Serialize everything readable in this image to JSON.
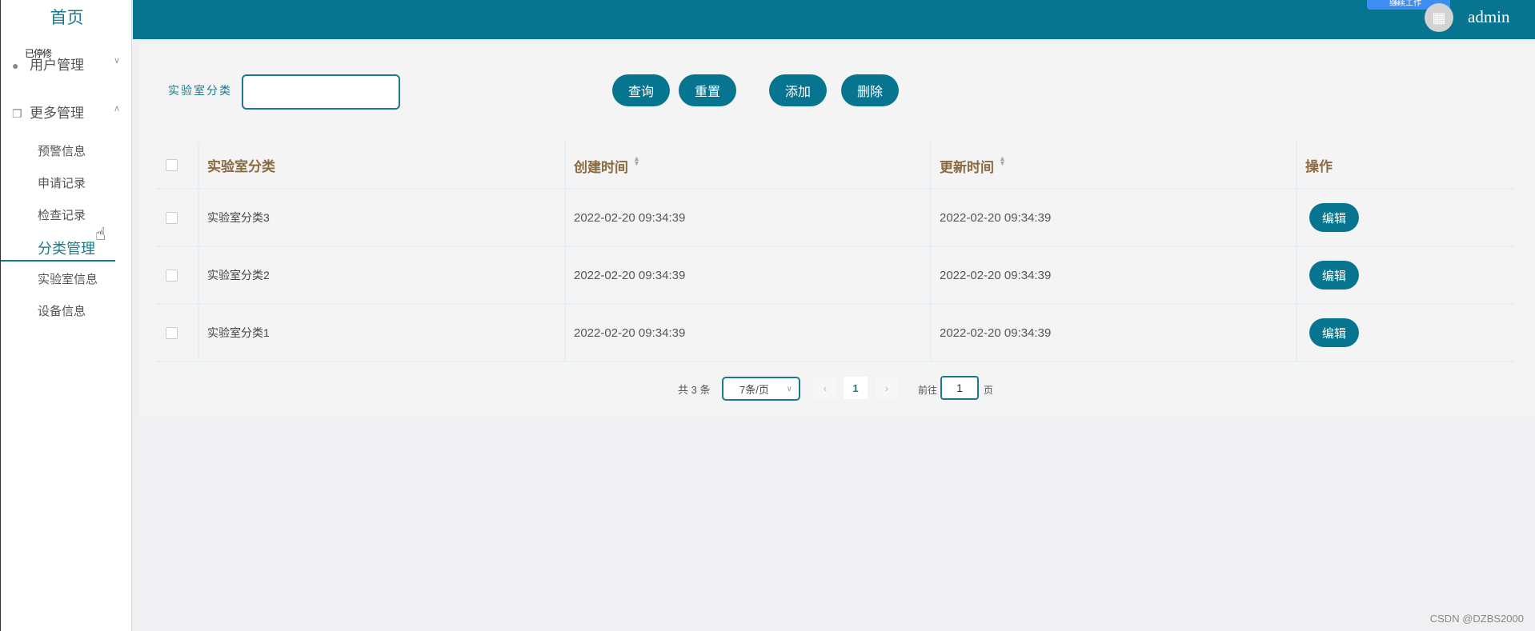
{
  "sidebar": {
    "home": "首页",
    "user_mgmt": "用户管理",
    "overlap_text": "已停修",
    "more_mgmt": "更多管理",
    "items": [
      {
        "label": "预警信息"
      },
      {
        "label": "申请记录"
      },
      {
        "label": "检查记录"
      },
      {
        "label": "分类管理"
      },
      {
        "label": "实验室信息"
      },
      {
        "label": "设备信息"
      }
    ],
    "icons": {
      "user": "user-icon",
      "more": "copy-icon",
      "chevron_down": "chevron-down-icon",
      "chevron_up": "chevron-up-icon"
    }
  },
  "header": {
    "username": "admin",
    "badge_text": "继续工作",
    "bg_color": "#077590"
  },
  "search": {
    "label": "实验室分类",
    "value": "",
    "placeholder": ""
  },
  "buttons": {
    "query": "查询",
    "reset": "重置",
    "add": "添加",
    "delete": "删除"
  },
  "table": {
    "headers": {
      "name": "实验室分类",
      "created": "创建时间",
      "updated": "更新时间",
      "action": "操作"
    },
    "rows": [
      {
        "name": "实验室分类3",
        "created": "2022-02-20 09:34:39",
        "updated": "2022-02-20 09:34:39",
        "action": "编辑"
      },
      {
        "name": "实验室分类2",
        "created": "2022-02-20 09:34:39",
        "updated": "2022-02-20 09:34:39",
        "action": "编辑"
      },
      {
        "name": "实验室分类1",
        "created": "2022-02-20 09:34:39",
        "updated": "2022-02-20 09:34:39",
        "action": "编辑"
      }
    ]
  },
  "pagination": {
    "total": "共 3 条",
    "page_size": "7条/页",
    "current_page": "1",
    "goto_label": "前往",
    "goto_value": "1",
    "page_unit": "页"
  },
  "watermark": "CSDN @DZBS2000",
  "accent_color": "#077590"
}
